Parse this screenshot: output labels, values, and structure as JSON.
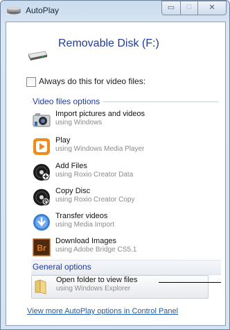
{
  "window": {
    "title": "AutoPlay"
  },
  "device": {
    "title": "Removable Disk (F:)"
  },
  "checkbox": {
    "label": "Always do this for video files:",
    "checked": false
  },
  "sections": {
    "video": "Video files options",
    "general": "General options"
  },
  "video_items": [
    {
      "label": "Import pictures and videos",
      "sub": "using Windows",
      "icon": "camera-icon"
    },
    {
      "label": "Play",
      "sub": "using Windows Media Player",
      "icon": "media-player-icon"
    },
    {
      "label": "Add Files",
      "sub": "using Roxio Creator Data",
      "icon": "roxio-disc-icon"
    },
    {
      "label": "Copy Disc",
      "sub": "using Roxio Creator Copy",
      "icon": "roxio-disc-icon"
    },
    {
      "label": "Transfer videos",
      "sub": "using Media Import",
      "icon": "media-import-icon"
    },
    {
      "label": "Download Images",
      "sub": "using Adobe Bridge CS5.1",
      "icon": "adobe-bridge-icon"
    }
  ],
  "general_items": [
    {
      "label": "Open folder to view files",
      "sub": "using Windows Explorer",
      "icon": "folder-icon"
    }
  ],
  "footer_link": "View more AutoPlay options in Control Panel",
  "colors": {
    "accent": "#1e3a9b",
    "link": "#1f5ba8",
    "window_frame": "#c9dbee"
  }
}
